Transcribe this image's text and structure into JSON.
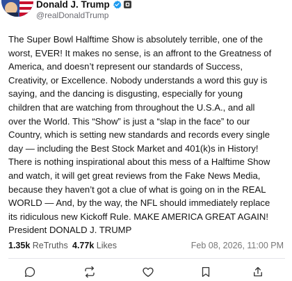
{
  "author": {
    "display_name": "Donald J. Trump",
    "handle": "@realDonaldTrump",
    "verified_color": "#1d9bf0"
  },
  "post": {
    "lines": [
      "The Super Bowl Halftime Show is absolutely terrible, one of the",
      "worst, EVER! It makes no sense, is an affront to the Greatness of",
      "America, and doesn’t represent our standards of Success,",
      "Creativity, or Excellence. Nobody understands a word this guy is",
      "saying, and the dancing is disgusting, especially for young",
      "children that are watching from throughout the U.S.A., and all",
      "over the World. This “Show” is just a “slap in the face” to our",
      "Country, which is setting new standards and records every single",
      "day — including the Best Stock Market and 401(k)s in History!",
      "There is nothing inspirational about this mess of a Halftime Show",
      "and watch, it will get great reviews from the Fake News Media,",
      "because they haven’t got a clue of what is going on in the REAL",
      "WORLD — And, by the way, the NFL should immediately replace",
      "its ridiculous new Kickoff Rule. MAKE AMERICA GREAT AGAIN!",
      "President DONALD J. TRUMP"
    ]
  },
  "stats": {
    "retruths_count": "1.35k",
    "retruths_label": "ReTruths",
    "likes_count": "4.77k",
    "likes_label": "Likes",
    "timestamp": "Feb 08, 2026, 11:00 PM"
  },
  "actions": [
    {
      "icon": "reply-icon"
    },
    {
      "icon": "retruth-icon"
    },
    {
      "icon": "heart-icon"
    },
    {
      "icon": "bookmark-icon"
    },
    {
      "icon": "share-icon"
    }
  ]
}
